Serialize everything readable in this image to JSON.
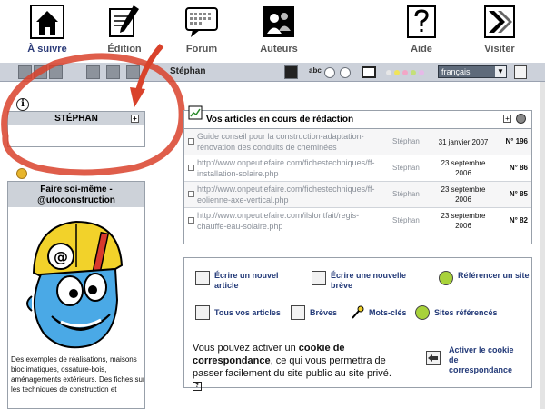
{
  "nav": {
    "items": [
      {
        "label": "À suivre",
        "icon": "home-icon",
        "active": true
      },
      {
        "label": "Édition",
        "icon": "pen-icon",
        "active": false
      },
      {
        "label": "Forum",
        "icon": "forum-icon",
        "active": false
      },
      {
        "label": "Auteurs",
        "icon": "authors-icon",
        "active": false
      },
      {
        "label": "Aide",
        "icon": "help-icon",
        "active": false
      },
      {
        "label": "Visiter",
        "icon": "visit-icon",
        "active": false
      }
    ]
  },
  "toolbar": {
    "username": "Stéphan",
    "spell": "abc",
    "language": "français"
  },
  "userbox": {
    "info_glyph": "i",
    "title": "STÉPHAN",
    "plus": "+"
  },
  "diy": {
    "title_line1": "Faire soi-même -",
    "title_line2": "@utoconstruction",
    "text": "Des exemples de réalisations, maisons bioclimatiques, ossature-bois, aménagements extérieurs. Des fiches sur les techniques de construction et"
  },
  "articles": {
    "title": "Vos articles en cours de rédaction",
    "plus": "+",
    "rows": [
      {
        "title": "Guide conseil pour la construction-adaptation-rénovation des conduits de cheminées",
        "author": "Stéphan",
        "date": "31 janvier 2007",
        "num": "N° 196"
      },
      {
        "title": "http://www.onpeutlefaire.com/fichestechniques/ff-installation-solaire.php",
        "author": "Stéphan",
        "date": "23 septembre 2006",
        "num": "N° 86"
      },
      {
        "title": "http://www.onpeutlefaire.com/fichestechniques/ff-eolienne-axe-vertical.php",
        "author": "Stéphan",
        "date": "23 septembre 2006",
        "num": "N° 85"
      },
      {
        "title": "http://www.onpeutlefaire.com/ilslontfait/regis-chauffe-eau-solaire.php",
        "author": "Stéphan",
        "date": "23 septembre 2006",
        "num": "N° 82"
      }
    ]
  },
  "actions": {
    "new_article": "Écrire un nouvel article",
    "new_brief": "Écrire une nouvelle brève",
    "reference_site": "Référencer un site",
    "all_articles": "Tous vos articles",
    "briefs": "Brèves",
    "keywords": "Mots-clés",
    "referenced_sites": "Sites référencés",
    "cookie_pre": "Vous pouvez activer un ",
    "cookie_bold": "cookie de correspondance",
    "cookie_post": ", ce qui vous permettra de passer facilement du site public au site privé.",
    "cookie_help": "?",
    "activate_cookie": "Activer le cookie de correspondance"
  },
  "colors": {
    "accent": "#2a3a78",
    "panel_header": "#cdd2d9",
    "annotation_red": "#d9422b"
  }
}
